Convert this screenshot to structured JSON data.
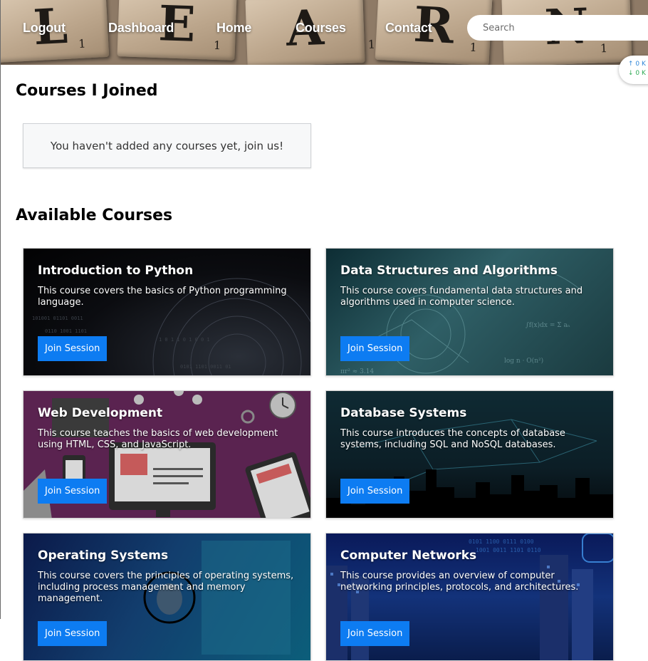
{
  "header": {
    "banner_letters": [
      "L",
      "E",
      "A",
      "R",
      "N"
    ],
    "banner_points": [
      "1",
      "1",
      "1",
      "1",
      "1"
    ],
    "nav": [
      {
        "label": "Logout"
      },
      {
        "label": "Dashboard"
      },
      {
        "label": "Home"
      },
      {
        "label": "Courses"
      },
      {
        "label": "Contact"
      }
    ],
    "search_placeholder": "Search",
    "speed_widget": {
      "up": "↑ 0 K",
      "down": "↓ 0 K"
    }
  },
  "joined": {
    "heading": "Courses I Joined",
    "empty_message": "You haven't added any courses yet, join us!"
  },
  "available": {
    "heading": "Available Courses",
    "courses": [
      {
        "title": "Introduction to Python",
        "description": "This course covers the basics of Python programming language.",
        "button": "Join Session",
        "theme": "python"
      },
      {
        "title": "Data Structures and Algorithms",
        "description": "This course covers fundamental data structures and algorithms used in computer science.",
        "button": "Join Session",
        "theme": "dsa"
      },
      {
        "title": "Web Development",
        "description": "This course teaches the basics of web development using HTML, CSS, and JavaScript.",
        "button": "Join Session",
        "theme": "web"
      },
      {
        "title": "Database Systems",
        "description": "This course introduces the concepts of database systems, including SQL and NoSQL databases.",
        "button": "Join Session",
        "theme": "db"
      },
      {
        "title": "Operating Systems",
        "description": "This course covers the principles of operating systems, including process management and memory management.",
        "button": "Join Session",
        "theme": "os"
      },
      {
        "title": "Computer Networks",
        "description": "This course provides an overview of computer networking principles, protocols, and architectures.",
        "button": "Join Session",
        "theme": "net"
      }
    ]
  },
  "colors": {
    "accent": "#0d7cf2",
    "header_overlay": "#8e7a66"
  }
}
